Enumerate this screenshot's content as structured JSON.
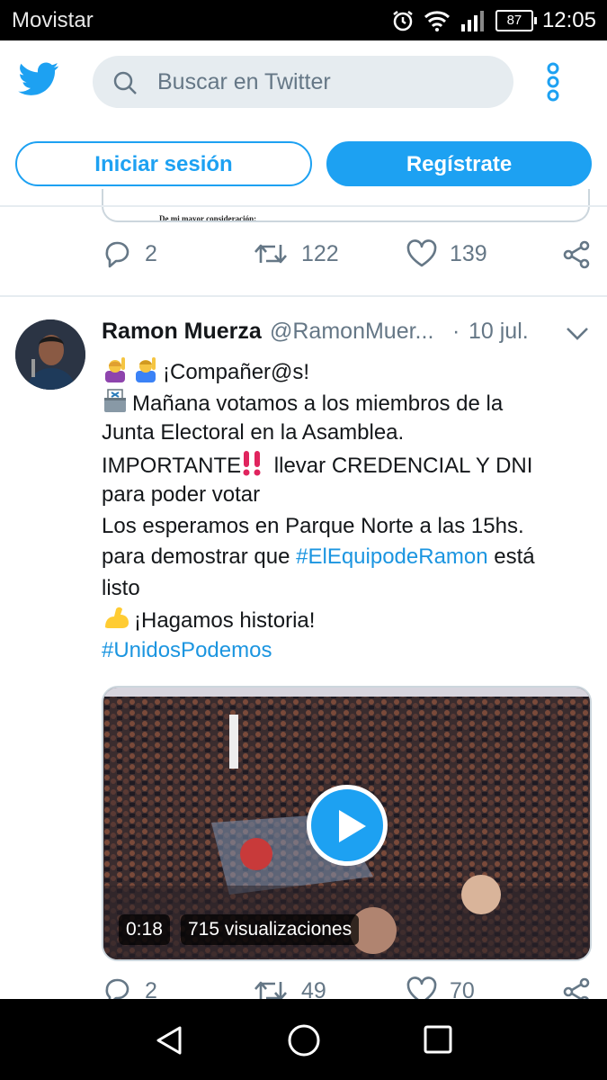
{
  "status_bar": {
    "carrier": "Movistar",
    "battery": "87",
    "time": "12:05"
  },
  "header": {
    "search_placeholder": "Buscar en Twitter"
  },
  "auth": {
    "login_label": "Iniciar sesión",
    "signup_label": "Regístrate"
  },
  "previous_tweet": {
    "card_text": "De mi mayor consideración:",
    "replies": "2",
    "retweets": "122",
    "likes": "139"
  },
  "tweet": {
    "name": "Ramon Muerza",
    "handle": "@RamonMuer...",
    "separator": "·",
    "date": "10 jul.",
    "lines": {
      "l1": "¡Compañer@s!",
      "l2": "Mañana votamos a los miembros de la",
      "l3": "Junta Electoral en la Asamblea.",
      "l4a": "IMPORTANTE",
      "l4b": " llevar CREDENCIAL Y DNI",
      "l5": "para poder votar",
      "l6": "Los esperamos en Parque Norte a las 15hs.",
      "l7a": "para demostrar que ",
      "l7b": "#ElEquipodeRamon",
      "l7c": " está",
      "l8": "listo",
      "l9": "¡Hagamos historia!",
      "l10": "#UnidosPodemos"
    },
    "video": {
      "duration": "0:18",
      "views": "715 visualizaciones"
    },
    "replies": "2",
    "retweets": "49",
    "likes": "70"
  },
  "colors": {
    "accent": "#1da1f2",
    "hashtag": "#1b95e0",
    "muted": "#657786"
  },
  "icons": [
    "twitter-logo-icon",
    "search-icon",
    "more-options-icon",
    "reply-icon",
    "retweet-icon",
    "like-icon",
    "share-icon",
    "chevron-down-icon",
    "play-icon",
    "back-icon",
    "home-icon",
    "recents-icon"
  ]
}
